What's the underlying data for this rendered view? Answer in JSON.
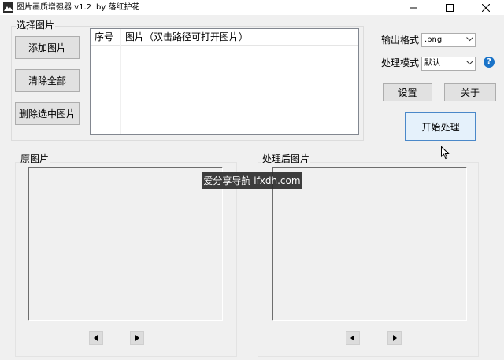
{
  "window": {
    "title": "图片画质增强器 v1.2",
    "author": "by 落红护花"
  },
  "select_group": {
    "label": "选择图片",
    "add_button": "添加图片",
    "clear_button": "清除全部",
    "delete_button": "删除选中图片",
    "list": {
      "columns": [
        "序号",
        "图片（双击路径可打开图片）"
      ],
      "rows": []
    }
  },
  "options": {
    "output_format_label": "输出格式",
    "output_format_value": ".png",
    "mode_label": "处理模式",
    "mode_value": "默认",
    "help_glyph": "?",
    "settings_button": "设置",
    "about_button": "关于",
    "start_button": "开始处理"
  },
  "original_group": {
    "label": "原图片"
  },
  "processed_group": {
    "label": "处理后图片"
  },
  "watermark": "爱分享导航 ifxdh.com",
  "colors": {
    "primary_border": "#4a88c9",
    "help_icon": "#1a73c8"
  }
}
